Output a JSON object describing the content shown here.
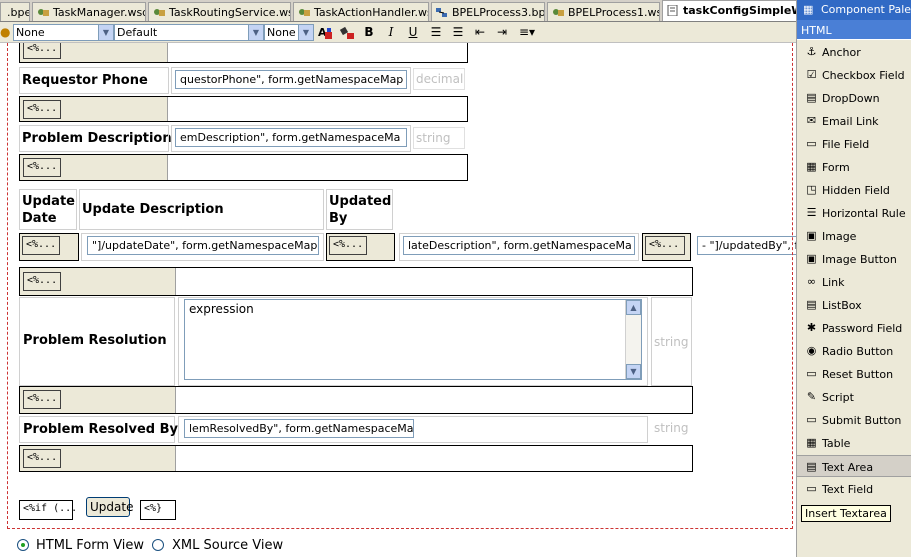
{
  "tabs": [
    {
      "label": ".bpel",
      "active": false
    },
    {
      "label": "TaskManager.wsdl",
      "active": false
    },
    {
      "label": "TaskRoutingService.wsdl",
      "active": false
    },
    {
      "label": "TaskActionHandler.wsdl",
      "active": false
    },
    {
      "label": "BPELProcess3.bpel",
      "active": false
    },
    {
      "label": "BPELProcess1.wsdl",
      "active": false
    },
    {
      "label": "taskConfigSimpleWo",
      "active": true
    }
  ],
  "toolbar": {
    "style_select": "None",
    "font_select": "Default",
    "size_select": "None",
    "bold": "B",
    "italic": "I",
    "underline": "U"
  },
  "form": {
    "tag_label": "<%...",
    "requestor_phone": {
      "label": "Requestor Phone",
      "value": "questorPhone\", form.getNamespaceMap",
      "type": "decimal"
    },
    "problem_description": {
      "label": "Problem Description",
      "value": "emDescription\", form.getNamespaceMa",
      "type": "string"
    },
    "updates": {
      "col_date": "Update Date",
      "col_description": "Update Description",
      "col_by": "Updated By",
      "date_value": "\"]/updateDate\", form.getNamespaceMap",
      "description_value": "lateDescription\", form.getNamespaceMa",
      "by_value": "- \"]/updatedBy\", fo"
    },
    "problem_resolution": {
      "label": "Problem Resolution",
      "value": "expression",
      "type": "string"
    },
    "problem_resolved_by": {
      "label": "Problem Resolved By",
      "value": "lemResolvedBy\", form.getNamespaceMa",
      "type": "string"
    },
    "if_tag": "<%if (...",
    "update_button": "Update",
    "close_tag": "<%}"
  },
  "view": {
    "html_form_view": "HTML Form View",
    "xml_source_view": "XML Source View",
    "selected": "html"
  },
  "palette": {
    "title": "Component Palette",
    "category": "HTML",
    "items": [
      {
        "label": "Anchor",
        "icon": "anchor-icon",
        "glyph": "⚓"
      },
      {
        "label": "Checkbox Field",
        "icon": "checkbox-icon",
        "glyph": "☑"
      },
      {
        "label": "DropDown",
        "icon": "dropdown-icon",
        "glyph": "▤"
      },
      {
        "label": "Email Link",
        "icon": "email-icon",
        "glyph": "✉"
      },
      {
        "label": "File Field",
        "icon": "file-icon",
        "glyph": "▭"
      },
      {
        "label": "Form",
        "icon": "form-icon",
        "glyph": "▦"
      },
      {
        "label": "Hidden Field",
        "icon": "hidden-field-icon",
        "glyph": "◳"
      },
      {
        "label": "Horizontal Rule",
        "icon": "horizontal-rule-icon",
        "glyph": "☰"
      },
      {
        "label": "Image",
        "icon": "image-icon",
        "glyph": "▣"
      },
      {
        "label": "Image Button",
        "icon": "image-button-icon",
        "glyph": "▣"
      },
      {
        "label": "Link",
        "icon": "link-icon",
        "glyph": "∞"
      },
      {
        "label": "ListBox",
        "icon": "listbox-icon",
        "glyph": "▤"
      },
      {
        "label": "Password Field",
        "icon": "password-icon",
        "glyph": "✱"
      },
      {
        "label": "Radio Button",
        "icon": "radio-icon",
        "glyph": "◉"
      },
      {
        "label": "Reset Button",
        "icon": "reset-icon",
        "glyph": "▭"
      },
      {
        "label": "Script",
        "icon": "script-icon",
        "glyph": "✎"
      },
      {
        "label": "Submit Button",
        "icon": "submit-icon",
        "glyph": "▭"
      },
      {
        "label": "Table",
        "icon": "table-icon",
        "glyph": "▦"
      },
      {
        "label": "Text Area",
        "icon": "text-area-icon",
        "glyph": "▤"
      },
      {
        "label": "Text Field",
        "icon": "text-field-icon",
        "glyph": "▭"
      }
    ],
    "selected_index": 18,
    "tooltip": "Insert Textarea"
  }
}
